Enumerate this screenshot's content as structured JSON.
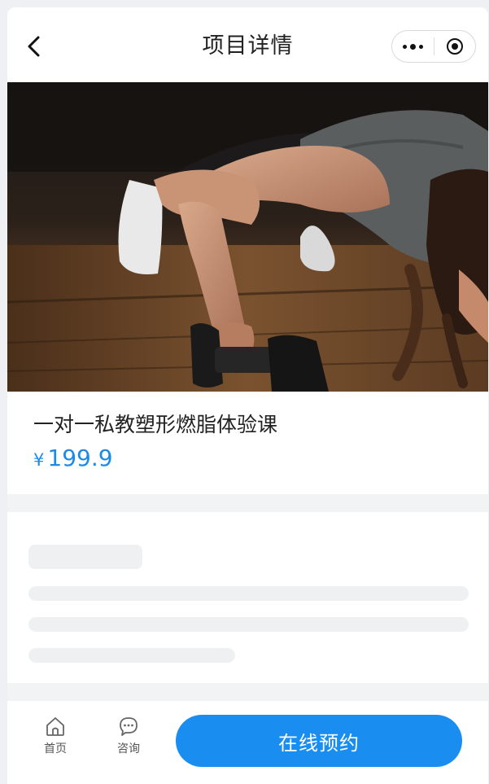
{
  "navbar": {
    "title": "项目详情",
    "back_icon": "chevron-left-icon",
    "more_icon": "more-dots-icon",
    "close_icon": "target-close-icon"
  },
  "hero": {
    "icon": "fitness-photo"
  },
  "product": {
    "name": "一对一私教塑形燃脂体验课",
    "price_symbol": "¥",
    "price": "199.9"
  },
  "bottom_bar": {
    "tabs": [
      {
        "label": "首页",
        "icon": "home-icon"
      },
      {
        "label": "咨询",
        "icon": "chat-bubble-icon"
      }
    ],
    "book_label": "在线预约"
  },
  "colors": {
    "accent": "#1a8df0",
    "price": "#1e8ae8",
    "page_bg": "#f2f3f5",
    "skeleton": "#eef0f2"
  }
}
